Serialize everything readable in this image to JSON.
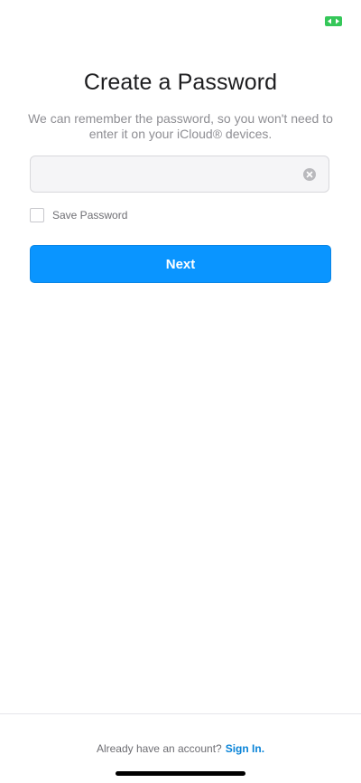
{
  "status_bar": {
    "icon": "screen-record-icon",
    "icon_color": "#35c759"
  },
  "header": {
    "title": "Create a Password",
    "subtitle": "We can remember the password, so you won't need to enter it on your iCloud® devices."
  },
  "password_field": {
    "value": "",
    "placeholder": "",
    "clear_icon": "clear-x-icon"
  },
  "save_password": {
    "label": "Save Password",
    "checked": false
  },
  "next_button": {
    "label": "Next",
    "color": "#0a95ff"
  },
  "footer": {
    "prompt": "Already have an account?",
    "link": "Sign In.",
    "link_color": "#0a84d8"
  }
}
